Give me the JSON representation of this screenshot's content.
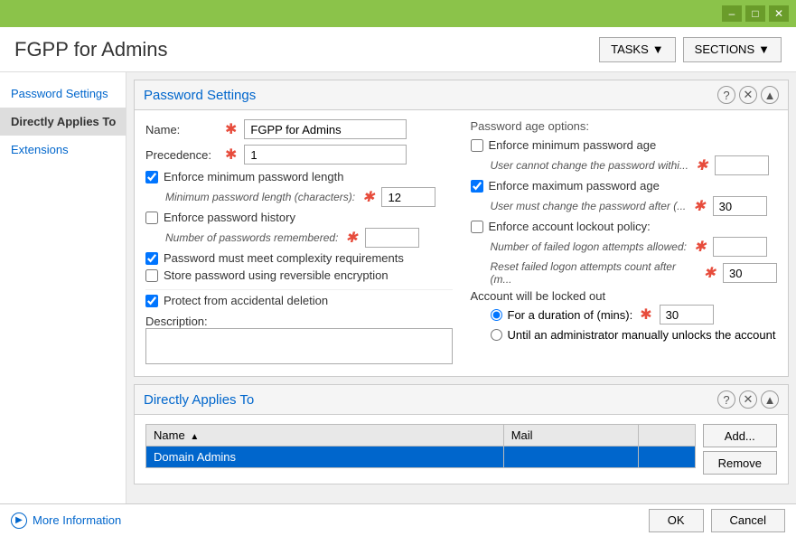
{
  "titleBar": {
    "minimizeLabel": "–",
    "maximizeLabel": "□",
    "closeLabel": "✕"
  },
  "header": {
    "appTitle": "FGPP for Admins",
    "tasksLabel": "TASKS",
    "sectionsLabel": "SECTIONS"
  },
  "sidebar": {
    "items": [
      {
        "id": "password-settings",
        "label": "Password Settings",
        "active": false
      },
      {
        "id": "directly-applies-to",
        "label": "Directly Applies To",
        "active": true
      },
      {
        "id": "extensions",
        "label": "Extensions",
        "active": false
      }
    ]
  },
  "passwordSettings": {
    "panelTitle": "Password Settings",
    "nameLabel": "Name:",
    "nameValue": "FGPP for Admins",
    "precedenceLabel": "Precedence:",
    "precedenceValue": "1",
    "enforceMinLength": {
      "label": "Enforce minimum password length",
      "checked": true,
      "subLabel": "Minimum password length (characters):",
      "value": "12"
    },
    "enforceHistory": {
      "label": "Enforce password history",
      "checked": false,
      "subLabel": "Number of passwords remembered:",
      "value": ""
    },
    "complexityLabel": "Password must meet complexity requirements",
    "complexityChecked": true,
    "reverseEncLabel": "Store password using reversible encryption",
    "reverseEncChecked": false,
    "protectDeletion": {
      "label": "Protect from accidental deletion",
      "checked": true
    },
    "descriptionLabel": "Description:",
    "passwordAgeOptions": {
      "sectionLabel": "Password age options:",
      "enforceMin": {
        "label": "Enforce minimum password age",
        "checked": false,
        "subLabel": "User cannot change the password withi...",
        "value": ""
      },
      "enforceMax": {
        "label": "Enforce maximum password age",
        "checked": true,
        "subLabel": "User must change the password after (...",
        "value": "30"
      },
      "lockout": {
        "label": "Enforce account lockout policy:",
        "checked": false,
        "failedAttemptsLabel": "Number of failed logon attempts allowed:",
        "failedAttemptsValue": "",
        "resetLabel": "Reset failed logon attempts count after (m...",
        "resetValue": "30",
        "accountLockedLabel": "Account will be locked out",
        "durationLabel": "For a duration of (mins):",
        "durationValue": "30",
        "durationRadio": true,
        "manualLabel": "Until an administrator manually unlocks the account",
        "manualRadio": false
      }
    }
  },
  "directlyAppliesTo": {
    "panelTitle": "Directly Applies To",
    "columns": [
      {
        "label": "Name",
        "sortable": true
      },
      {
        "label": "Mail"
      },
      {
        "label": ""
      }
    ],
    "rows": [
      {
        "name": "Domain Admins",
        "mail": "",
        "selected": true
      }
    ],
    "addButtonLabel": "Add...",
    "removeButtonLabel": "Remove"
  },
  "statusBar": {
    "moreInfoLabel": "More Information",
    "okLabel": "OK",
    "cancelLabel": "Cancel"
  }
}
